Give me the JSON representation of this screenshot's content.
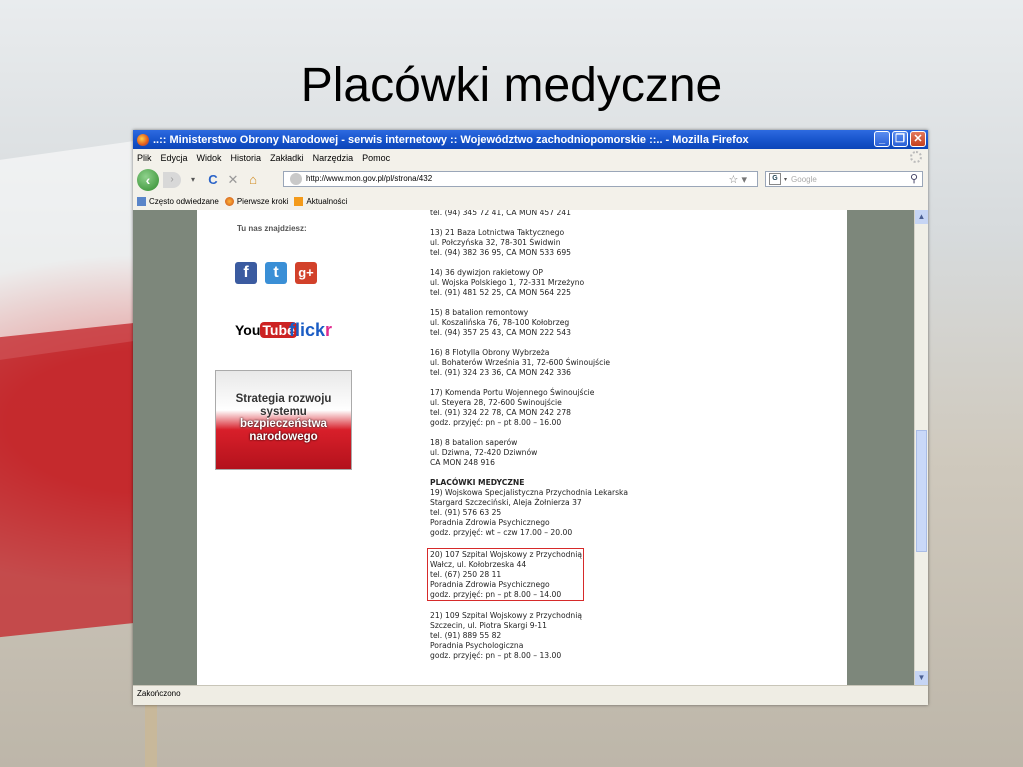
{
  "slide": {
    "title": "Placówki medyczne"
  },
  "window": {
    "title": "..:: Ministerstwo Obrony Narodowej - serwis internetowy :: Województwo zachodniopomorskie ::.. - Mozilla Firefox",
    "menu": [
      "Plik",
      "Edycja",
      "Widok",
      "Historia",
      "Zakładki",
      "Narzędzia",
      "Pomoc"
    ],
    "url": "http://www.mon.gov.pl/pl/strona/432",
    "search_placeholder": "Google",
    "bookmarks": [
      "Często odwiedzane",
      "Pierwsze kroki",
      "Aktualności"
    ],
    "status": "Zakończono"
  },
  "sidebar": {
    "tunas": "Tu nas znajdziesz:",
    "social": [
      {
        "name": "facebook-icon",
        "glyph": "f",
        "color": "#3b5ba0"
      },
      {
        "name": "twitter-icon",
        "glyph": "t",
        "color": "#3a8fd6"
      },
      {
        "name": "google-plus-icon",
        "glyph": "g+",
        "color": "#d2412a"
      }
    ],
    "youtube_you": "You",
    "youtube_tube": "Tube",
    "flickr_a": "flick",
    "flickr_b": "r",
    "strategia": [
      "Strategia rozwoju",
      "systemu",
      "bezpieczeństwa",
      "narodowego"
    ]
  },
  "entries": [
    "tel. (94) 345 72 41, CA MON 457 241",
    "13) 21 Baza Lotnictwa Taktycznego\nul. Połczyńska 32, 78-301 Świdwin\ntel. (94) 382 36 95, CA MON 533 695",
    "14) 36 dywizjon rakietowy OP\nul. Wojska Polskiego 1, 72-331 Mrzeżyno\ntel. (91) 481 52 25, CA MON 564 225",
    "15) 8 batalion remontowy\nul. Koszalińska 76, 78-100 Kołobrzeg\ntel. (94) 357 25 43, CA MON 222 543",
    "16) 8 Flotylla Obrony Wybrzeża\nul. Bohaterów Września 31, 72-600 Świnoujście\ntel. (91) 324 23 36, CA MON 242 336",
    "17) Komenda Portu Wojennego Świnoujście\nul. Steyera 28, 72-600 Świnoujście\ntel. (91) 324 22 78, CA MON 242 278\ngodz. przyjęć: pn – pt 8.00 – 16.00",
    "18) 8 batalion saperów\nul. Dziwna, 72-420 Dziwnów\nCA MON 248 916"
  ],
  "medical_header": "PLACÓWKI MEDYCZNE",
  "medical": [
    "19) Wojskowa Specjalistyczna Przychodnia Lekarska\nStargard Szczeciński, Aleja Żołnierza 37\ntel. (91) 576 63 25\nPoradnia Zdrowia Psychicznego\ngodz. przyjęć: wt – czw 17.00 – 20.00",
    "20) 107 Szpital Wojskowy z Przychodnią\nWałcz, ul. Kołobrzeska 44\ntel. (67) 250 28 11\nPoradnia Zdrowia Psychicznego\ngodz. przyjęć: pn – pt 8.00 – 14.00",
    "21) 109 Szpital Wojskowy z Przychodnią\nSzczecin, ul. Piotra Skargi 9-11\ntel. (91) 889 55 82\nPoradnia Psychologiczna\ngodz. przyjęć: pn – pt 8.00 – 13.00"
  ]
}
